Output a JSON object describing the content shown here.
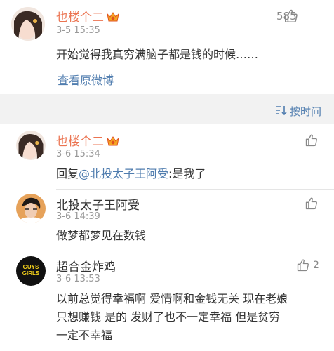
{
  "post": {
    "username": "也楼个二",
    "time": "3-5 15:35",
    "likes": "585",
    "content": "开始觉得我真穷满脑子都是钱的时候……",
    "view_original": "查看原微博"
  },
  "sort": {
    "label": "按时间"
  },
  "comments": [
    {
      "username": "也楼个二",
      "time": "3-6 15:34",
      "reply_prefix": "回复",
      "mention": "@北投太子王阿受",
      "content_rest": ":是我了",
      "likes": ""
    },
    {
      "username": "北投太子王阿受",
      "time": "3-6 14:39",
      "content": "做梦都梦见在数钱",
      "likes": ""
    },
    {
      "username": "超合金炸鸡",
      "time": "3-6 13:53",
      "likes": "2",
      "avatar_text_1": "GUYS",
      "avatar_text_2": "GIRLS",
      "lines": [
        "以前总觉得幸福啊 爱情啊和金钱无关  现在老娘",
        "只想赚钱  是的 发财了也不一定幸福  但是贫穷",
        "一定不幸福"
      ]
    }
  ],
  "colors": {
    "username": "#eb7350",
    "link": "#507daf",
    "text": "#333333",
    "meta": "#999999"
  }
}
